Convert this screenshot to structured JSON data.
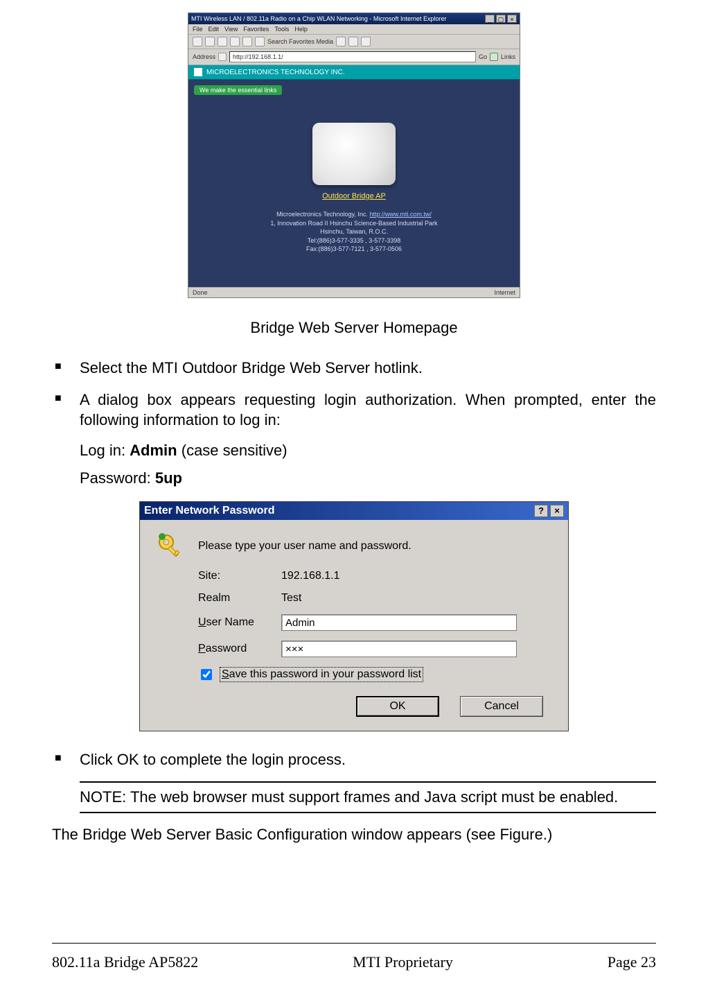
{
  "figure1": {
    "titlebar": "MTI Wireless LAN / 802.11a Radio on a Chip WLAN Networking - Microsoft Internet Explorer",
    "menus": [
      "File",
      "Edit",
      "View",
      "Favorites",
      "Tools",
      "Help"
    ],
    "toolbar_text": "Search  Favorites  Media",
    "address_label": "Address",
    "address_value": "http://192.168.1.1/",
    "go_label": "Go",
    "links_label": "Links",
    "banner": "MICROELECTRONICS TECHNOLOGY INC.",
    "slogan": "We make the essential links",
    "device_link": "Outdoor Bridge AP",
    "company_line": "Microelectronics Technology, Inc.",
    "company_url": "http://www.mti.com.tw/",
    "addr1": "1, Innovation Road II Hsinchu Science-Based Industrial Park",
    "addr2": "Hsinchu, Taiwan, R.O.C.",
    "tel": "Tel:(886)3-577-3335 , 3-577-3398",
    "fax": "Fax:(886)3-577-7121 , 3-577-0506",
    "status_left": "Done",
    "status_right": "Internet"
  },
  "caption1": "Bridge Web Server Homepage",
  "bullets": {
    "b1": "Select the MTI Outdoor Bridge Web Server hotlink.",
    "b2": "A dialog box appears requesting login authorization. When prompted, enter the following information to log in:",
    "login_prefix": "Log in: ",
    "login_value": "Admin",
    "login_suffix": " (case sensitive)",
    "password_prefix": "Password: ",
    "password_value": "5up",
    "b3": "Click OK to complete the login process."
  },
  "dialog": {
    "title": "Enter Network Password",
    "help_btn": "?",
    "close_btn": "×",
    "prompt": "Please type your user name and password.",
    "site_label": "Site:",
    "site_value": "192.168.1.1",
    "realm_label": "Realm",
    "realm_value": "Test",
    "user_label_pre": "U",
    "user_label_post": "ser Name",
    "user_value": "Admin",
    "pass_label_pre": "P",
    "pass_label_post": "assword",
    "pass_value": "×××",
    "save_label_pre": "S",
    "save_label_post": "ave this password in your password list",
    "ok": "OK",
    "cancel": "Cancel"
  },
  "note": "NOTE: The web browser must support frames and Java script must be enabled.",
  "trailing": "The Bridge Web Server Basic Configuration window appears (see Figure.)",
  "footer": {
    "left": "802.11a Bridge  AP5822",
    "center": "MTI Proprietary",
    "right": "Page 23"
  }
}
